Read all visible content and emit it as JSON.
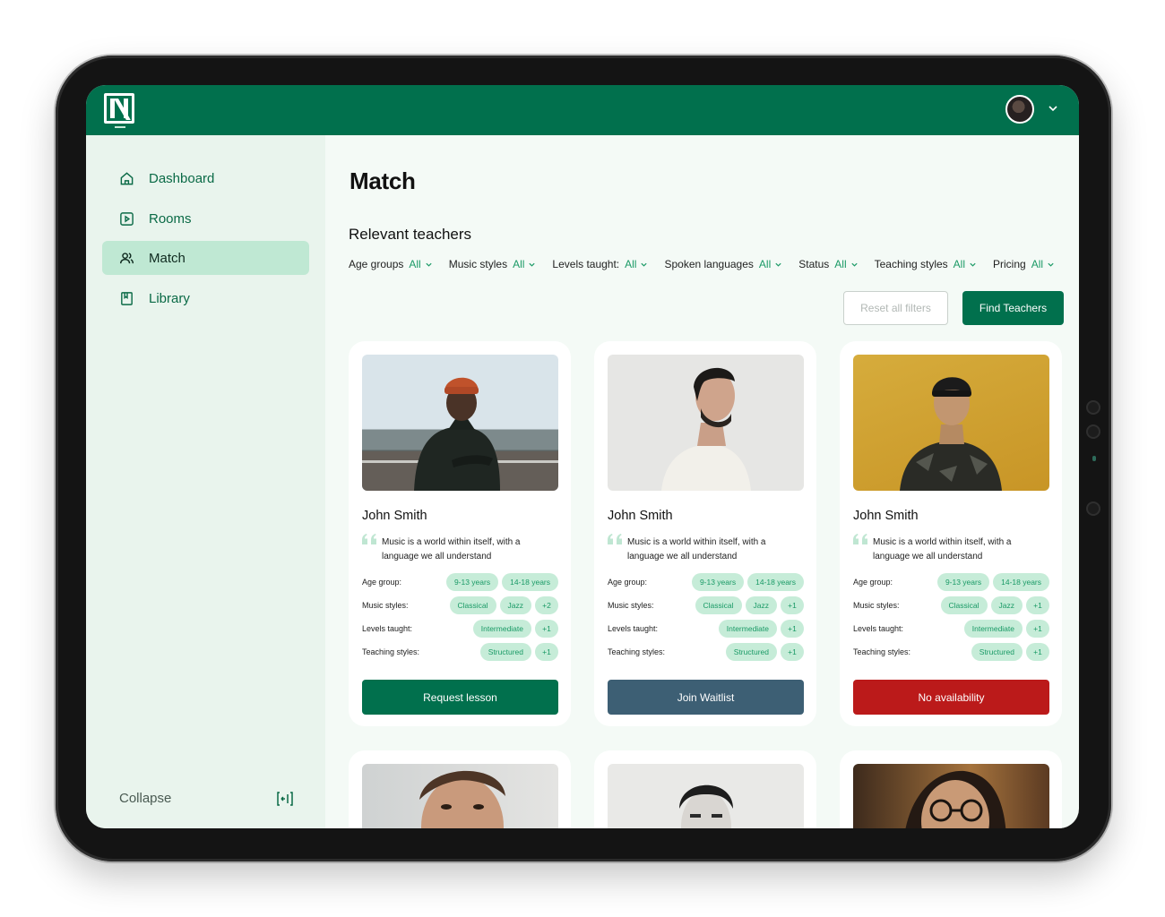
{
  "brand": {
    "logo_icon": "n-logo-icon"
  },
  "header": {
    "avatar_icon": "user-avatar",
    "menu_icon": "chevron-down-icon"
  },
  "sidebar": {
    "items": [
      {
        "label": "Dashboard",
        "icon": "home-icon",
        "active": false
      },
      {
        "label": "Rooms",
        "icon": "play-square-icon",
        "active": false
      },
      {
        "label": "Match",
        "icon": "users-icon",
        "active": true
      },
      {
        "label": "Library",
        "icon": "book-icon",
        "active": false
      }
    ],
    "collapse_label": "Collapse",
    "collapse_icon": "collapse-sidebar-icon"
  },
  "main": {
    "title": "Match",
    "section_title": "Relevant teachers",
    "filters": [
      {
        "label": "Age groups",
        "value": "All"
      },
      {
        "label": "Music styles",
        "value": "All"
      },
      {
        "label": "Levels taught:",
        "value": "All"
      },
      {
        "label": "Spoken languages",
        "value": "All"
      },
      {
        "label": "Status",
        "value": "All"
      },
      {
        "label": "Teaching styles",
        "value": "All"
      },
      {
        "label": "Pricing",
        "value": "All"
      }
    ],
    "reset_label": "Reset all filters",
    "find_label": "Find Teachers"
  },
  "teachers": [
    {
      "name": "John Smith",
      "quote": "Music is a world within itself, with a language we all understand",
      "age_label": "Age group:",
      "age_chips": [
        "9-13 years",
        "14-18 years"
      ],
      "styles_label": "Music styles:",
      "styles_chips": [
        "Classical",
        "Jazz"
      ],
      "styles_more": "+2",
      "levels_label": "Levels taught:",
      "levels_chips": [
        "Intermediate"
      ],
      "levels_more": "+1",
      "teaching_label": "Teaching styles:",
      "teaching_chips": [
        "Structured"
      ],
      "teaching_more": "+1",
      "action_label": "Request lesson",
      "action_color": "#01704d"
    },
    {
      "name": "John Smith",
      "quote": "Music is a world within itself, with a language we all understand",
      "age_label": "Age group:",
      "age_chips": [
        "9-13 years",
        "14-18 years"
      ],
      "styles_label": "Music styles:",
      "styles_chips": [
        "Classical",
        "Jazz"
      ],
      "styles_more": "+1",
      "levels_label": "Levels taught:",
      "levels_chips": [
        "Intermediate"
      ],
      "levels_more": "+1",
      "teaching_label": "Teaching styles:",
      "teaching_chips": [
        "Structured"
      ],
      "teaching_more": "+1",
      "action_label": "Join Waitlist",
      "action_color": "#3d5f74"
    },
    {
      "name": "John Smith",
      "quote": "Music is a world within itself, with a language we all understand",
      "age_label": "Age group:",
      "age_chips": [
        "9-13 years",
        "14-18 years"
      ],
      "styles_label": "Music styles:",
      "styles_chips": [
        "Classical",
        "Jazz"
      ],
      "styles_more": "+1",
      "levels_label": "Levels taught:",
      "levels_chips": [
        "Intermediate"
      ],
      "levels_more": "+1",
      "teaching_label": "Teaching styles:",
      "teaching_chips": [
        "Structured"
      ],
      "teaching_more": "+1",
      "action_label": "No availability",
      "action_color": "#bb1a1a"
    }
  ],
  "colors": {
    "brand_green": "#01704d",
    "chip_bg": "#c6ecd8",
    "chip_text": "#1a9a66",
    "active_nav": "#bfe8d3"
  }
}
